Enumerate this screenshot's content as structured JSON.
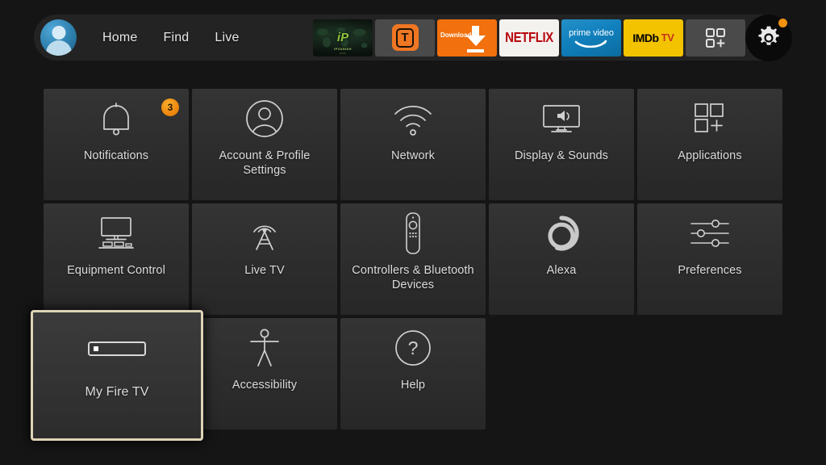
{
  "nav": {
    "avatar": "profile-avatar",
    "links": [
      {
        "label": "Home"
      },
      {
        "label": "Find"
      },
      {
        "label": "Live"
      }
    ],
    "apps": [
      {
        "name": "ipvanish",
        "logo": "iP",
        "brand": "IPVANISH",
        "sub": "VPN"
      },
      {
        "name": "troypoint",
        "letter": "T"
      },
      {
        "name": "downloader",
        "label": "Downloader"
      },
      {
        "name": "netflix",
        "label": "NETFLIX"
      },
      {
        "name": "prime-video",
        "label": "prime video"
      },
      {
        "name": "imdb-tv",
        "label": "IMDb",
        "suffix": "TV"
      },
      {
        "name": "apps-grid",
        "label": ""
      }
    ],
    "settings": {
      "icon": "gear-icon",
      "has_notification": true,
      "dot_color": "#f0920e"
    }
  },
  "grid": {
    "rows": [
      [
        {
          "label": "Notifications",
          "icon": "bell-icon",
          "badge": "3"
        },
        {
          "label": "Account & Profile Settings",
          "icon": "person-circle-icon"
        },
        {
          "label": "Network",
          "icon": "wifi-icon"
        },
        {
          "label": "Display & Sounds",
          "icon": "tv-speaker-icon"
        },
        {
          "label": "Applications",
          "icon": "apps-plus-icon"
        }
      ],
      [
        {
          "label": "Equipment Control",
          "icon": "tv-stand-icon"
        },
        {
          "label": "Live TV",
          "icon": "broadcast-tower-icon"
        },
        {
          "label": "Controllers & Bluetooth Devices",
          "icon": "remote-icon"
        },
        {
          "label": "Alexa",
          "icon": "alexa-ring-icon"
        },
        {
          "label": "Preferences",
          "icon": "sliders-icon"
        }
      ],
      [
        {
          "label": "My Fire TV",
          "icon": "firetv-stick-icon",
          "focused": true
        },
        {
          "label": "Accessibility",
          "icon": "accessibility-icon"
        },
        {
          "label": "Help",
          "icon": "question-circle-icon"
        }
      ]
    ]
  },
  "colors": {
    "background": "#151515",
    "tile": "#2e2e2e",
    "accent_orange": "#f0920e",
    "focus_border": "#ded3b6",
    "text": "#dcdcdc"
  }
}
